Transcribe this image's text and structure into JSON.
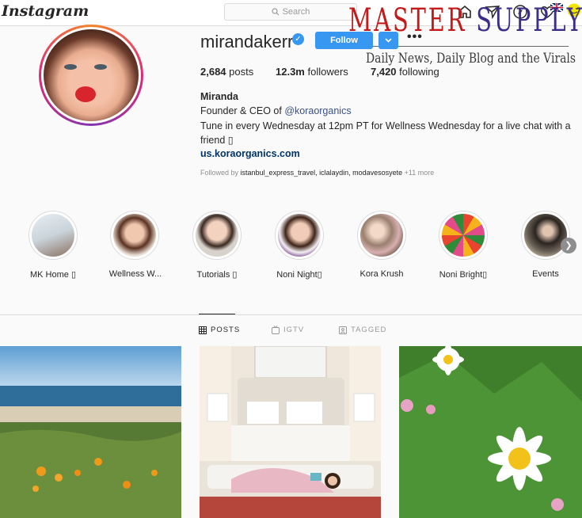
{
  "app": {
    "logo": "Instagram"
  },
  "search": {
    "placeholder": "Search"
  },
  "watermark": {
    "title_red": "MASTER",
    "title_blue": "SUPPLY",
    "subtitle": "Daily News, Daily Blog and the Virals"
  },
  "profile": {
    "username": "mirandakerr",
    "follow_label": "Follow",
    "more_label": "•••",
    "posts_count": "2,684",
    "posts_label": "posts",
    "followers_count": "12.3m",
    "followers_label": "followers",
    "following_count": "7,420",
    "following_label": "following",
    "full_name": "Miranda",
    "bio_line1_prefix": "Founder & CEO of ",
    "bio_line1_link": "@koraorganics",
    "bio_line2": "Tune in every Wednesday at 12pm PT for Wellness Wednesday for a live chat with a",
    "bio_line3": "friend ▯",
    "website": "us.koraorganics.com",
    "followed_by_prefix": "Followed by ",
    "followed_by_users": "istanbul_express_travel, iclalaydin, modavesosyete",
    "followed_by_more": " +11 more"
  },
  "highlights": [
    {
      "label": "MK Home ▯"
    },
    {
      "label": "Wellness W..."
    },
    {
      "label": "Tutorials ▯"
    },
    {
      "label": "Noni Night▯"
    },
    {
      "label": "Kora Krush"
    },
    {
      "label": "Noni Bright▯"
    },
    {
      "label": "Events"
    }
  ],
  "tabs": [
    {
      "label": "POSTS",
      "icon": "grid-icon",
      "active": true
    },
    {
      "label": "IGTV",
      "icon": "igtv-icon",
      "active": false
    },
    {
      "label": "TAGGED",
      "icon": "tag-icon",
      "active": false
    }
  ],
  "colors": {
    "accent": "#3897f0",
    "watermark_red": "#c41a1a",
    "watermark_blue": "#3b2d88",
    "link": "#003569"
  }
}
